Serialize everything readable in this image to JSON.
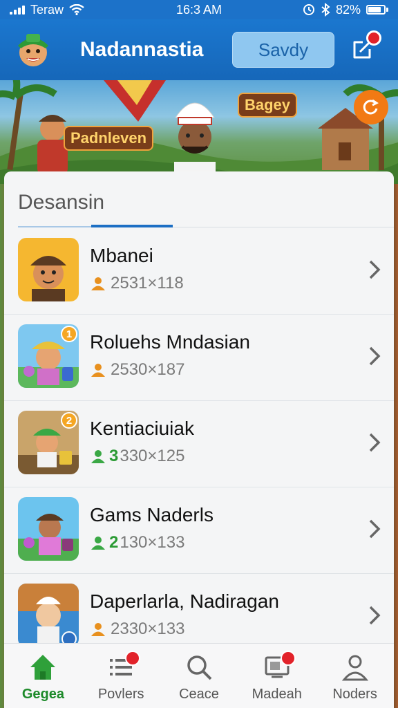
{
  "status_bar": {
    "carrier": "Teraw",
    "time": "16:3 AM",
    "battery": "82%"
  },
  "header": {
    "title": "Nadannastia",
    "save_label": "Savdy"
  },
  "banner": {
    "label_left": "Padnleven",
    "label_right": "Bagey"
  },
  "panel": {
    "title": "Desansin"
  },
  "items": [
    {
      "name": "Mbanei",
      "stats_lead": "",
      "stats": "2531×118",
      "icon_color": "#e8901e",
      "badge": ""
    },
    {
      "name": "Roluehs Mndasian",
      "stats_lead": "",
      "stats": "2530×187",
      "icon_color": "#e8901e",
      "badge": "1"
    },
    {
      "name": "Kentiaciuiak",
      "stats_lead": "3",
      "stats": "330×125",
      "icon_color": "#3aa845",
      "badge": "2"
    },
    {
      "name": "Gams Naderls",
      "stats_lead": "2",
      "stats": "130×133",
      "icon_color": "#3aa845",
      "badge": ""
    },
    {
      "name": "Daperlarla, Nadiragan",
      "stats_lead": "",
      "stats": "2330×133",
      "icon_color": "#e8901e",
      "badge": ""
    }
  ],
  "nav": [
    {
      "label": "Gegea",
      "icon": "home-icon",
      "active": true
    },
    {
      "label": "Povlers",
      "icon": "list-icon",
      "badge": true
    },
    {
      "label": "Ceace",
      "icon": "search-icon"
    },
    {
      "label": "Madeah",
      "icon": "media-icon",
      "badge": true
    },
    {
      "label": "Noders",
      "icon": "profile-icon"
    }
  ],
  "colors": {
    "primary": "#1b77cf",
    "active_nav": "#1d8a2a",
    "badge": "#e2222a",
    "accent": "#f27a14"
  }
}
